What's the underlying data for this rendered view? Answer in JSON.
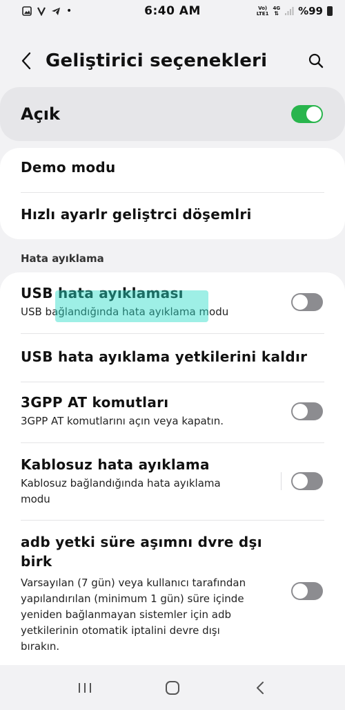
{
  "status_bar": {
    "time": "6:40 AM",
    "net_top": "Vo)",
    "net_bottom": "LTE1",
    "net_gen": "4G",
    "battery": "%99",
    "icons": [
      "gallery-icon",
      "v-icon",
      "telegram-icon",
      "dot-icon",
      "signal-icon",
      "battery-icon"
    ]
  },
  "header": {
    "title": "Geliştirici seçenekleri"
  },
  "master": {
    "label": "Açık",
    "on": true
  },
  "card_top": {
    "items": [
      {
        "title": "Demo modu"
      },
      {
        "title": "Hızlı ayarlr geliştrci döşemlri"
      }
    ]
  },
  "section": {
    "label": "Hata ayıklama"
  },
  "debug": {
    "items": [
      {
        "title": "USB hata ayıklaması",
        "subtitle": "USB bağlandığında hata ayıklama modu",
        "toggle": false
      },
      {
        "title": "USB hata ayıklama yetkilerini kaldır"
      },
      {
        "title": "3GPP AT komutları",
        "subtitle": "3GPP AT komutlarını açın veya kapatın.",
        "toggle": false
      },
      {
        "title": "Kablosuz hata ayıklama",
        "subtitle_line1": "Kablosuz bağlandığında hata ayıklama",
        "subtitle_line2": "modu",
        "toggle": false
      },
      {
        "title_line1": "adb yetki süre aşımnı dvre dşı",
        "title_line2": "birk",
        "subtitle_line1": "Varsayılan (7 gün) veya kullanıcı tarafından",
        "subtitle_line2": "yapılandırılan (minimum 1 gün) süre içinde",
        "subtitle_line3": "yeniden bağlanmayan sistemler için adb",
        "subtitle_line4": "yetkilerinin otomatik iptalini devre dışı",
        "subtitle_line5": "bırakın.",
        "toggle": false
      }
    ]
  },
  "nav": {
    "buttons": [
      "recents-icon",
      "home-icon",
      "back-icon"
    ]
  },
  "colors": {
    "accent_on": "#29b54d",
    "toggle_off": "#8c8c90",
    "highlight": "#28dcc8"
  }
}
